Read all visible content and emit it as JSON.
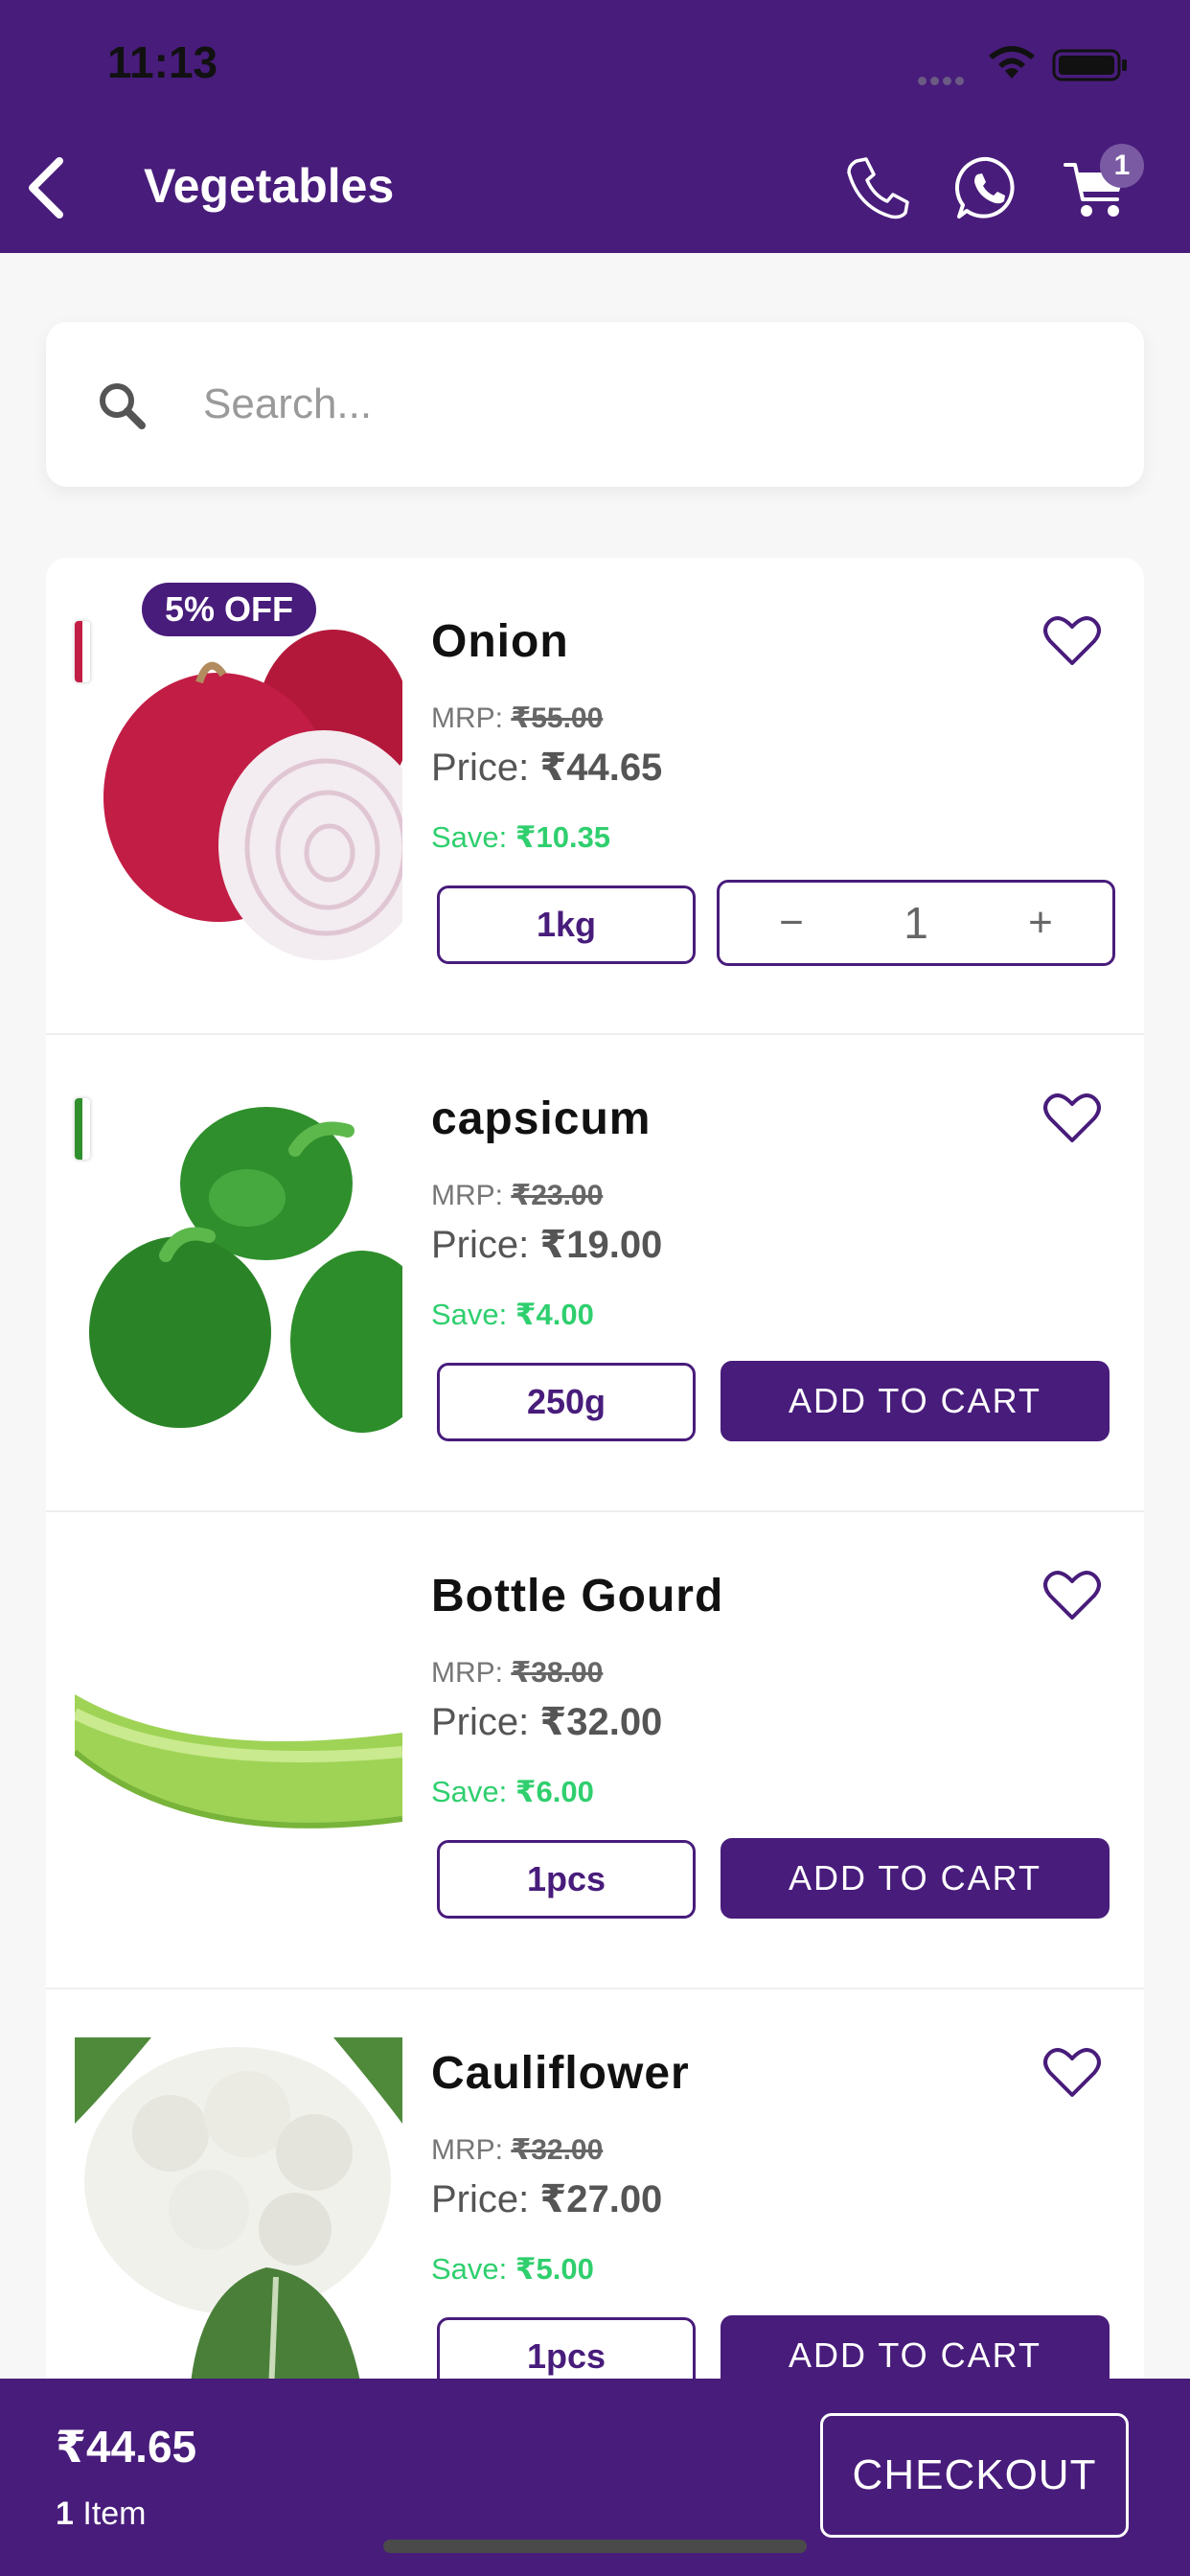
{
  "status_bar": {
    "time": "11:13"
  },
  "header": {
    "title": "Vegetables",
    "back_icon": "chevron-left-icon",
    "call_icon": "phone-icon",
    "whatsapp_icon": "whatsapp-icon",
    "cart_icon": "cart-icon",
    "cart_count": "1"
  },
  "search": {
    "placeholder": "Search...",
    "value": ""
  },
  "products": [
    {
      "discount": "5% OFF",
      "name": "Onion",
      "mrp_label": "MRP:",
      "mrp": "₹55.00",
      "price_label": "Price:",
      "price": "₹44.65",
      "save_label": "Save:",
      "save": "₹10.35",
      "variant": "1kg",
      "quantity": "1",
      "minus": "−",
      "plus": "+"
    },
    {
      "name": "capsicum",
      "mrp_label": "MRP:",
      "mrp": "₹23.00",
      "price_label": "Price:",
      "price": "₹19.00",
      "save_label": "Save:",
      "save": "₹4.00",
      "variant": "250g",
      "action": "ADD TO CART"
    },
    {
      "name": "Bottle Gourd",
      "mrp_label": "MRP:",
      "mrp": "₹38.00",
      "price_label": "Price:",
      "price": "₹32.00",
      "save_label": "Save:",
      "save": "₹6.00",
      "variant": "1pcs",
      "action": "ADD TO CART"
    },
    {
      "name": "Cauliflower",
      "mrp_label": "MRP:",
      "mrp": "₹32.00",
      "price_label": "Price:",
      "price": "₹27.00",
      "save_label": "Save:",
      "save": "₹5.00",
      "variant": "1pcs",
      "action": "ADD TO CART"
    }
  ],
  "footer": {
    "total": "₹44.65",
    "item_count": "1",
    "item_label": "Item",
    "checkout": "CHECKOUT"
  },
  "colors": {
    "brand": "#481c7b",
    "save_green": "#2fcf6e",
    "background": "#f7f7f8"
  }
}
